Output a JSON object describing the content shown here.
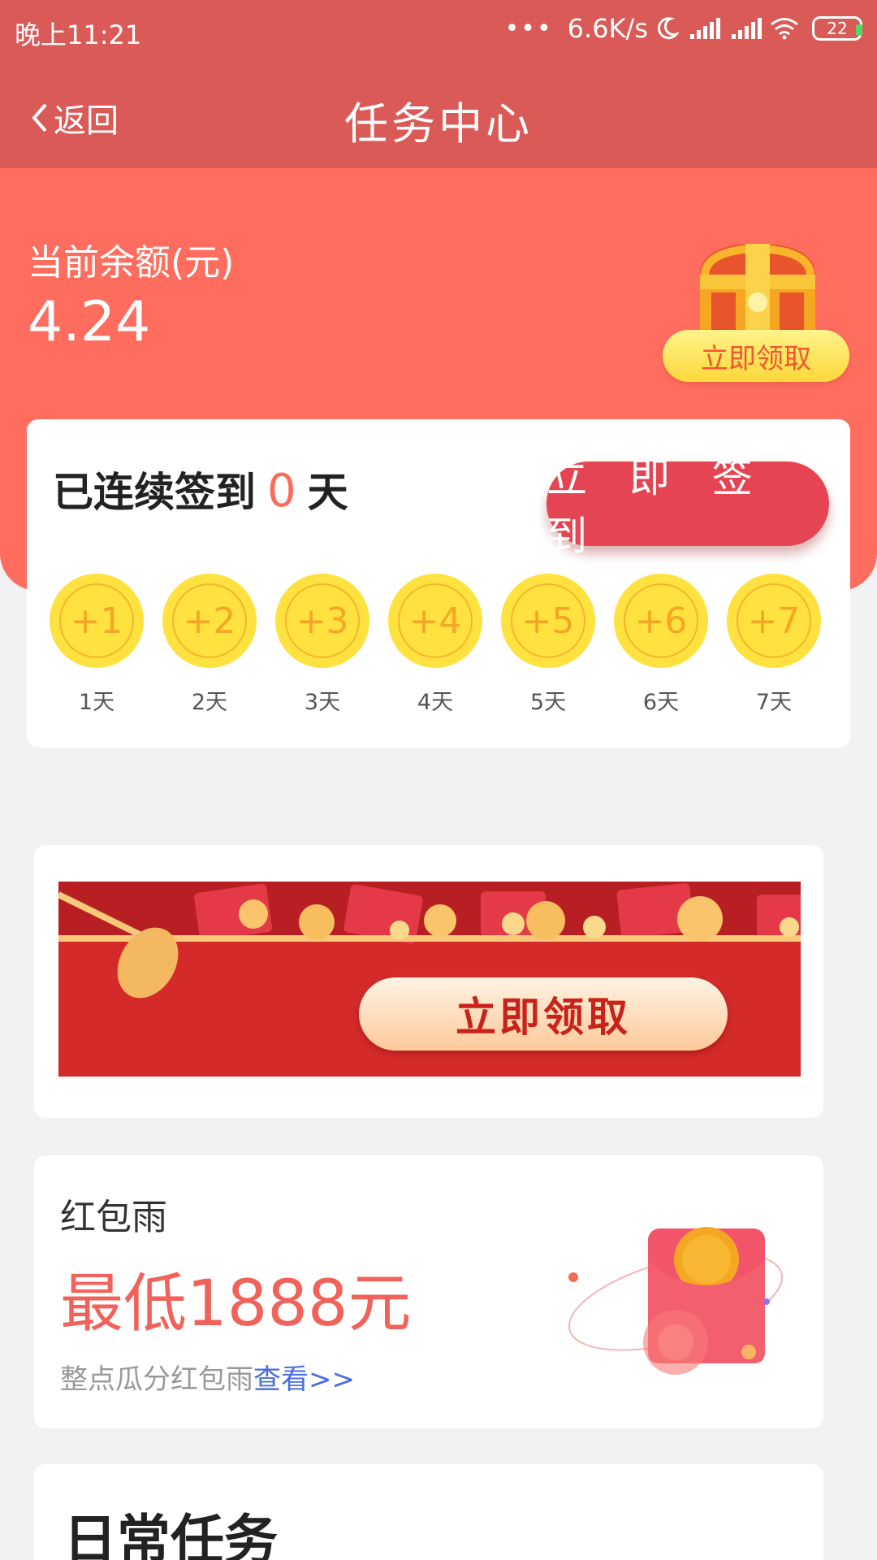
{
  "status_bar": {
    "time": "晚上11:21",
    "speed": "6.6K/s",
    "battery": "22"
  },
  "nav": {
    "back_label": "返回",
    "title": "任务中心"
  },
  "balance": {
    "label": "当前余额(元)",
    "value": "4.24",
    "claim_label": "立即领取"
  },
  "signin": {
    "prefix": "已连续签到",
    "days_count": "0",
    "suffix": "天",
    "button_label": "立 即 签 到",
    "days": [
      {
        "reward": "+1",
        "label": "1天"
      },
      {
        "reward": "+2",
        "label": "2天"
      },
      {
        "reward": "+3",
        "label": "3天"
      },
      {
        "reward": "+4",
        "label": "4天"
      },
      {
        "reward": "+5",
        "label": "5天"
      },
      {
        "reward": "+6",
        "label": "6天"
      },
      {
        "reward": "+7",
        "label": "7天"
      }
    ]
  },
  "banner": {
    "button_label": "立即领取"
  },
  "red_envelope_rain": {
    "title": "红包雨",
    "amount": "最低1888元",
    "description": "整点瓜分红包雨",
    "link": "查看>>"
  },
  "daily_tasks": {
    "title": "日常任务"
  },
  "colors": {
    "header": "#d95a56",
    "hero": "#fe6d5e",
    "accent": "#e54553",
    "coin": "#ffe23f",
    "link": "#4a6ee0"
  }
}
